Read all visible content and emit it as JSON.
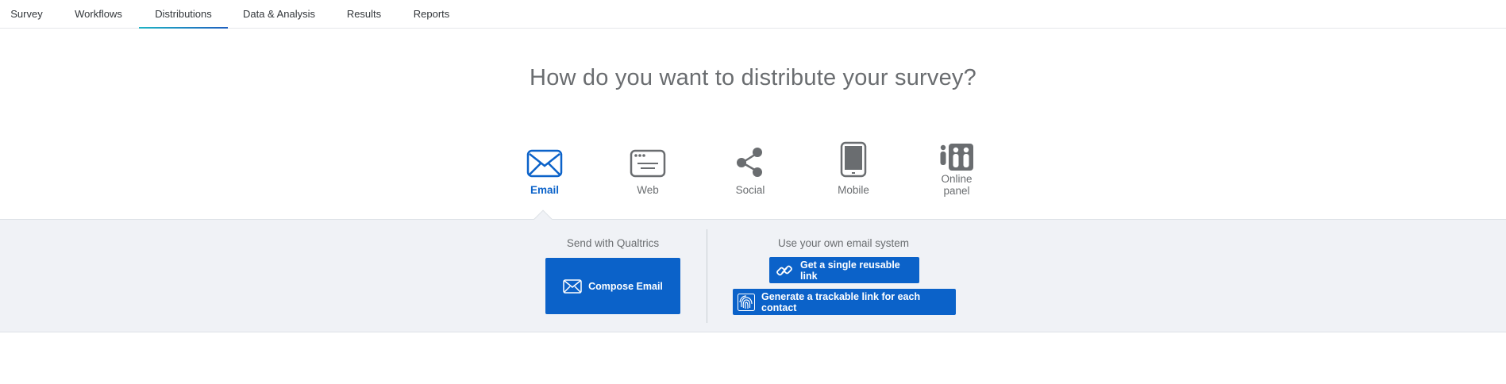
{
  "nav": {
    "tabs": [
      {
        "label": "Survey"
      },
      {
        "label": "Workflows"
      },
      {
        "label": "Distributions"
      },
      {
        "label": "Data & Analysis"
      },
      {
        "label": "Results"
      },
      {
        "label": "Reports"
      }
    ],
    "active_tab": "Distributions"
  },
  "headline": "How do you want to distribute your survey?",
  "methods": [
    {
      "label": "Email",
      "icon": "envelope-icon",
      "active": true
    },
    {
      "label": "Web",
      "icon": "browser-window-icon"
    },
    {
      "label": "Social",
      "icon": "share-icon"
    },
    {
      "label": "Mobile",
      "icon": "mobile-phone-icon"
    },
    {
      "label": "Online panel",
      "line1": "Online",
      "line2": "panel",
      "icon": "people-panel-icon"
    }
  ],
  "email_panel": {
    "qualtrics_title": "Send with Qualtrics",
    "compose_label": "Compose Email",
    "own_system_title": "Use your own email system",
    "reusable_link_label": "Get a single reusable link",
    "trackable_link_label": "Generate a trackable link for each contact"
  },
  "colors": {
    "accent": "#0b62c9",
    "panel_bg": "#f0f2f6",
    "icon_gray": "#6a6d70"
  }
}
